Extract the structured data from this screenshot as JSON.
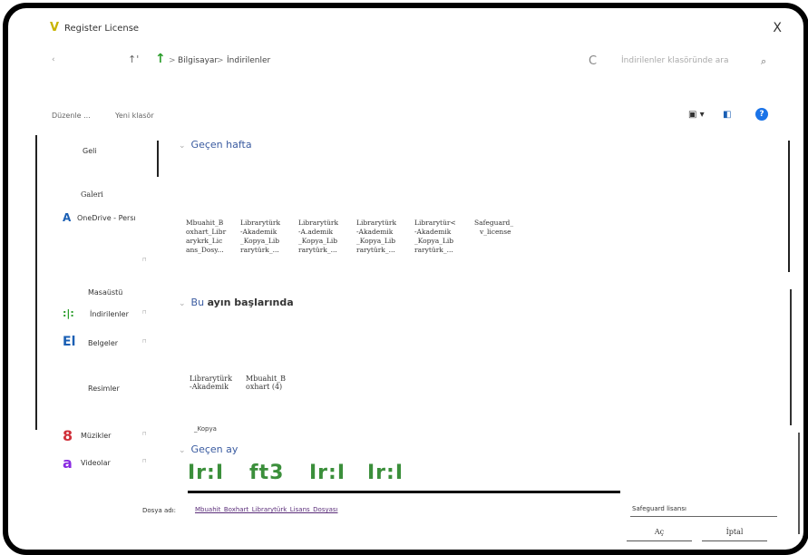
{
  "window": {
    "title": "Register License",
    "app_icon": "V",
    "close": "X"
  },
  "nav": {
    "back": "‹",
    "up_arrow": "↑",
    "breadcrumb": [
      "Bilgisayar",
      "İndirilenler"
    ],
    "refresh": "C",
    "search_placeholder": "İndirilenler klasöründe ara",
    "search_icon": "⌕"
  },
  "commands": {
    "organize": "Düzenle ...",
    "new_folder": "Yeni klasör"
  },
  "sidebar": {
    "items": [
      {
        "label": "Geli",
        "icon": ""
      },
      {
        "label": "Galeri",
        "icon": ""
      },
      {
        "label": "OneDrive - Persı",
        "icon": "A",
        "icon_color": "#1a5fb4"
      },
      {
        "label": "Masaüstü",
        "icon": ""
      },
      {
        "label": "İndirilenler",
        "icon": ":|:",
        "icon_color": "#2a9d2a"
      },
      {
        "label": "Belgeler",
        "icon": "El",
        "icon_color": "#1a5fb4"
      },
      {
        "label": "Resimler",
        "icon": ""
      },
      {
        "label": "Müzikler",
        "icon": "8",
        "icon_color": "#d0303a"
      },
      {
        "label": "Videolar",
        "icon": "a",
        "icon_color": "#8a2be2"
      }
    ]
  },
  "groups": {
    "last_week": "Geçen hafta",
    "this_month_prefix": "Bu",
    "this_month_bold": "ayın başlarında",
    "last_month": "Geçen ay"
  },
  "files_last_week": [
    {
      "l1": "Mbuahit_B",
      "l2": "oxhart_Libr",
      "l3": "arykrk_Lic",
      "l4": "ans_Dosy..."
    },
    {
      "l1": "Librarytürk",
      "l2": "-Akademik",
      "l3": "_Kopya_Lib",
      "l4": "rarytürk_..."
    },
    {
      "l1": "Librarytürk",
      "l2": "-A.ademik",
      "l3": "_Kopya_Lib",
      "l4": "rarytürk_..."
    },
    {
      "l1": "Librarytürk",
      "l2": "-Akademik",
      "l3": "_Kopya_Lib",
      "l4": "rarytürk_..."
    },
    {
      "l1": "Librarytür<",
      "l2": "-Akademik",
      "l3": "_Kopya_Lib",
      "l4": "rarytürk_..."
    },
    {
      "l1": "Safeguard_",
      "l2": "v_license",
      "l3": "",
      "l4": ""
    }
  ],
  "files_this_month": [
    {
      "l1": "Librarytürk",
      "l2": "-Akademik"
    },
    {
      "l1": "Mbuahit_B",
      "l2": "oxhart (4)"
    }
  ],
  "file_partial": "_Kopya",
  "thumbs": [
    "Ir:I",
    "ft3",
    "Ir:I",
    "Ir:I"
  ],
  "footer": {
    "filename_label": "Dosya adı:",
    "filename_value": "Mbuahit_Boxhart_Librarytürk_Lisans_Dosyası",
    "filter": "Safeguard lisansı",
    "open": "Aç",
    "cancel": "İptal"
  }
}
